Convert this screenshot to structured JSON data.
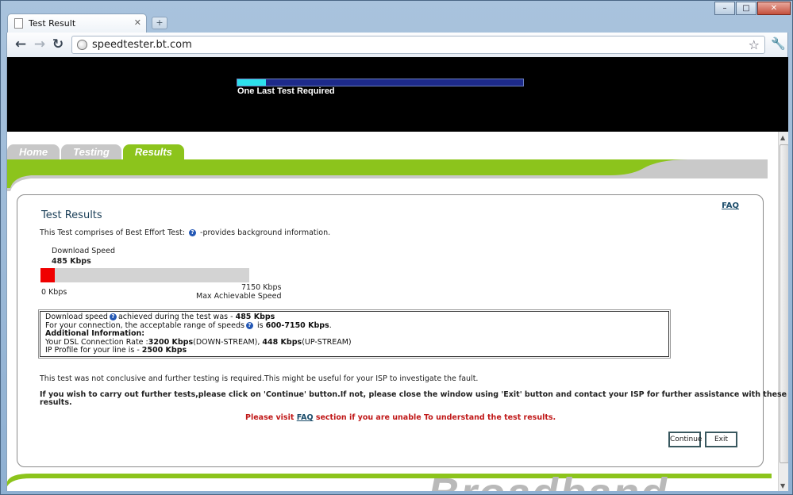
{
  "browser": {
    "tab_title": "Test Result",
    "url": "speedtester.bt.com"
  },
  "banner": {
    "progress_fraction": 0.1,
    "progress_label": "One Last Test Required"
  },
  "nav_tabs": [
    {
      "label": "Home",
      "active": false
    },
    {
      "label": "Testing",
      "active": false
    },
    {
      "label": "Results",
      "active": true
    }
  ],
  "results": {
    "faq_link": "FAQ",
    "title": "Test Results",
    "intro_before": "This Test comprises of Best Effort Test:",
    "intro_after": "-provides background information.",
    "download_label": "Download  Speed",
    "download_value": "485 Kbps",
    "gauge_fraction": 0.0678,
    "scale_min": "0 Kbps",
    "scale_max": "7150 Kbps",
    "scale_max_caption": "Max Achievable Speed",
    "box": {
      "line1_a": "Download speed",
      "line1_b": "achieved during the test was - ",
      "line1_value": "485 Kbps",
      "line2_a": "For your connection, the acceptable range of speeds",
      "line2_b": " is ",
      "line2_value": "600-7150 Kbps",
      "line2_end": ".",
      "additional_heading": "Additional Information:",
      "line4_a": "Your DSL Connection Rate :",
      "line4_down": "3200 Kbps",
      "line4_down_label": "(DOWN-STREAM), ",
      "line4_up": "448 Kbps",
      "line4_up_label": "(UP-STREAM)",
      "line5_a": "IP Profile for your line is - ",
      "line5_value": "2500 Kbps"
    },
    "inconclusive_note": "This test was not conclusive and further testing is required.This might be useful for your ISP to investigate the fault.",
    "instructions_line1": "If you wish to carry out further tests,please click on 'Continue' button.If not, please close the window using 'Exit' button and contact your ISP for further assistance with these",
    "instructions_line2": "results.",
    "faq_note_before": "Please visit ",
    "faq_note_link": "FAQ",
    "faq_note_after": " section if you are unable To understand the test results.",
    "continue_label": "Continue",
    "exit_label": "Exit"
  },
  "footer": {
    "brand_text": "Broadband"
  },
  "colors": {
    "accent_green": "#8cc41c",
    "gauge_red": "#f00000",
    "progress_cyan": "#2de0ec"
  }
}
